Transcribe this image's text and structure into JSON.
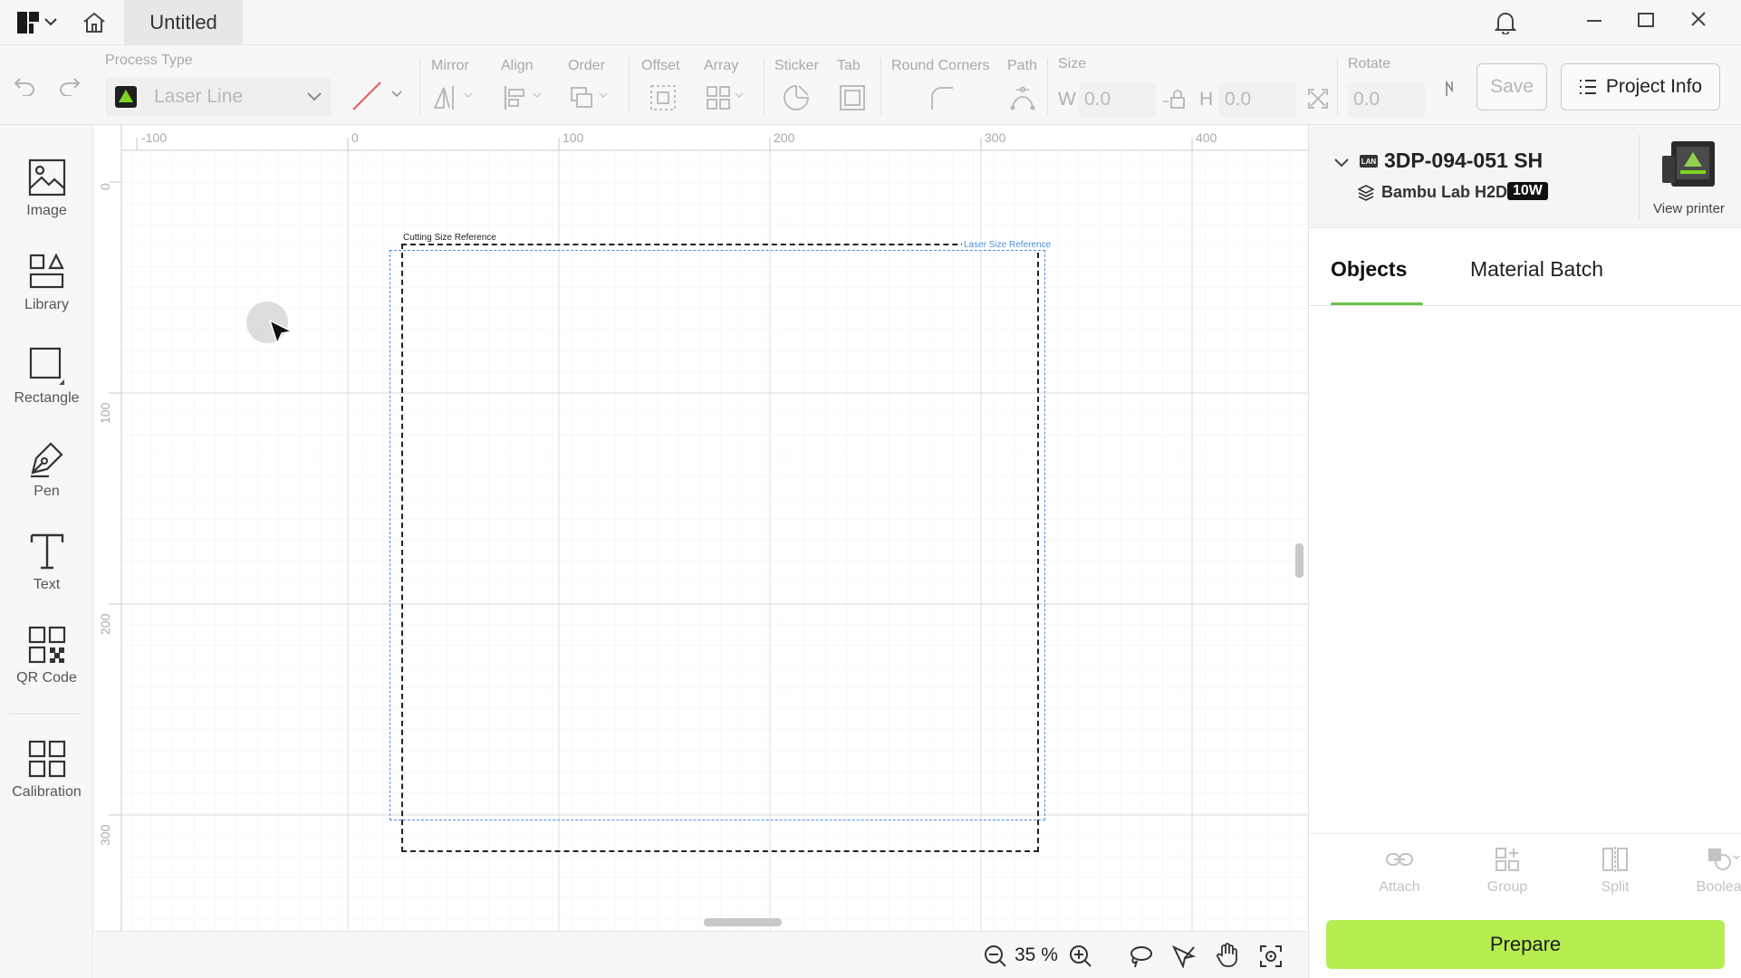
{
  "window": {
    "tab_title": "Untitled"
  },
  "toolbar": {
    "process_type_label": "Process Type",
    "process_type_value": "Laser Line",
    "groups": {
      "mirror": "Mirror",
      "align": "Align",
      "order": "Order",
      "offset": "Offset",
      "array": "Array",
      "sticker": "Sticker",
      "tab": "Tab",
      "round_corners": "Round Corners",
      "path": "Path",
      "size": "Size",
      "rotate": "Rotate"
    },
    "width_label": "W",
    "width_value": "0.0",
    "height_label": "H",
    "height_value": "0.0",
    "rotate_value": "0.0",
    "save_label": "Save",
    "project_info_label": "Project Info"
  },
  "sidebar": {
    "items": [
      {
        "label": "Image",
        "icon": "image-icon"
      },
      {
        "label": "Library",
        "icon": "library-icon"
      },
      {
        "label": "Rectangle",
        "icon": "rectangle-icon"
      },
      {
        "label": "Pen",
        "icon": "pen-icon"
      },
      {
        "label": "Text",
        "icon": "text-icon"
      },
      {
        "label": "QR Code",
        "icon": "qr-code-icon"
      },
      {
        "label": "Calibration",
        "icon": "calibration-icon"
      }
    ]
  },
  "canvas": {
    "ruler_x": [
      "-100",
      "0",
      "100",
      "200",
      "300",
      "400"
    ],
    "ruler_y": [
      "0",
      "100",
      "200",
      "300"
    ],
    "cutting_ref_label": "Cutting Size Reference",
    "laser_ref_label": "Laser Size Reference"
  },
  "bottombar": {
    "zoom": "35 %"
  },
  "printer": {
    "name": "3DP-094-051 SH",
    "connection": "LAN",
    "model": "Bambu Lab H2D",
    "power_badge": "10W",
    "view_printer_label": "View printer"
  },
  "panel": {
    "tabs": [
      {
        "label": "Objects",
        "active": true
      },
      {
        "label": "Material Batch",
        "active": false
      }
    ],
    "object_tools": [
      "Attach",
      "Group",
      "Split",
      "Boolean"
    ],
    "prepare_label": "Prepare"
  },
  "colors": {
    "accent_green": "#b6ee52",
    "tab_underline": "#6cc24a",
    "cut_reference": "#222222",
    "laser_reference": "#4a90e2"
  }
}
